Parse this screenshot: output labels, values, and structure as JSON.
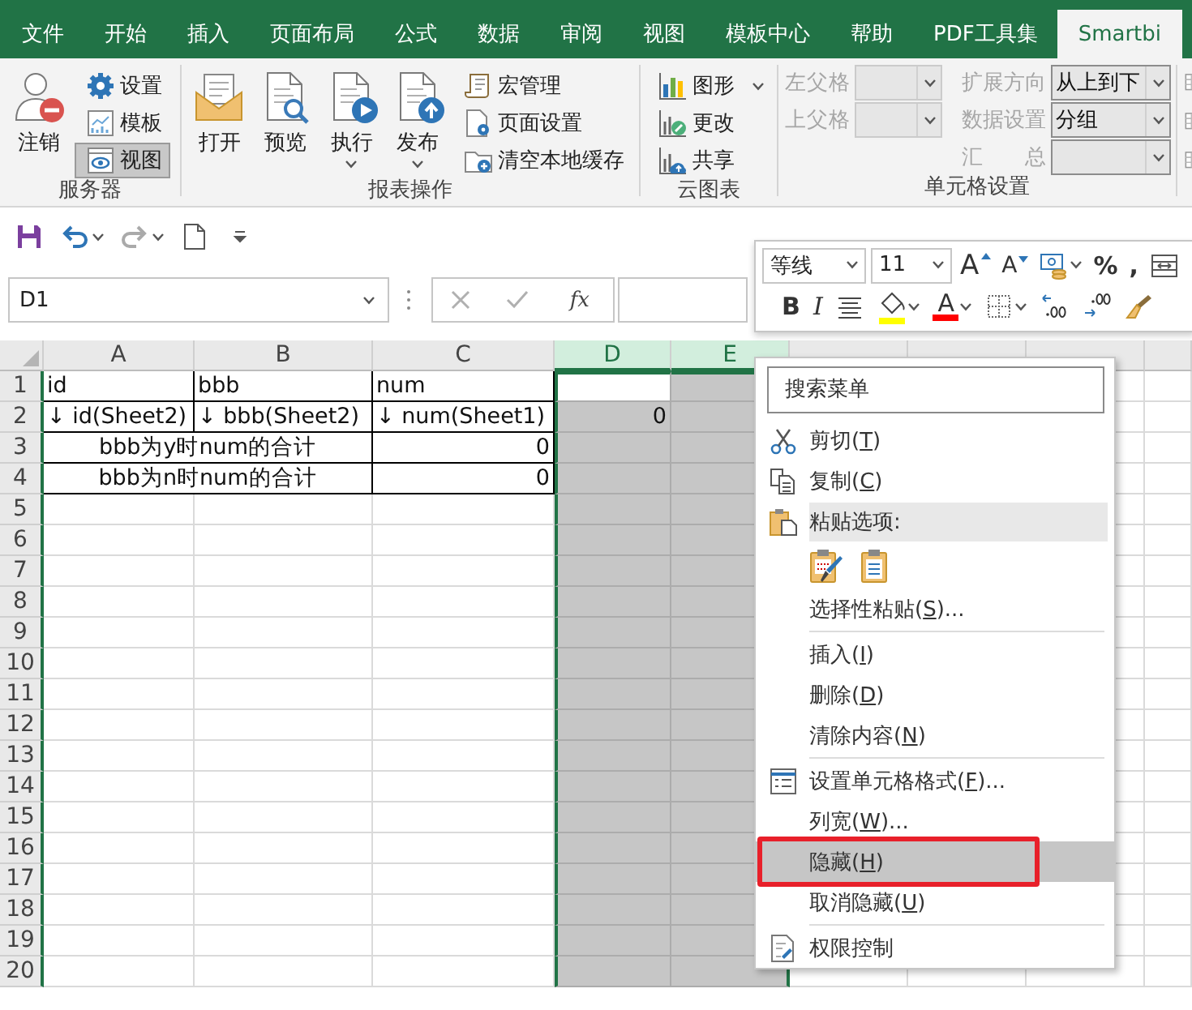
{
  "tabs": [
    {
      "label": "文件",
      "selected": false
    },
    {
      "label": "开始",
      "selected": false
    },
    {
      "label": "插入",
      "selected": false
    },
    {
      "label": "页面布局",
      "selected": false
    },
    {
      "label": "公式",
      "selected": false
    },
    {
      "label": "数据",
      "selected": false
    },
    {
      "label": "审阅",
      "selected": false
    },
    {
      "label": "视图",
      "selected": false
    },
    {
      "label": "模板中心",
      "selected": false
    },
    {
      "label": "帮助",
      "selected": false
    },
    {
      "label": "PDF工具集",
      "selected": false
    },
    {
      "label": "Smartbi",
      "selected": true
    }
  ],
  "ribbon": {
    "groups": [
      {
        "kind": "buttons",
        "label": "服务器",
        "items": [
          {
            "kind": "large",
            "label": "注销",
            "dropdown": false
          },
          {
            "kind": "small",
            "label": "设置",
            "dropdown": false,
            "selected": false
          },
          {
            "kind": "small",
            "label": "模板",
            "dropdown": false,
            "selected": false
          },
          {
            "kind": "small",
            "label": "视图",
            "dropdown": false,
            "selected": true
          }
        ]
      },
      {
        "kind": "buttons",
        "label": "报表操作",
        "items": [
          {
            "kind": "large",
            "label": "打开",
            "dropdown": false
          },
          {
            "kind": "large",
            "label": "预览",
            "dropdown": false
          },
          {
            "kind": "large",
            "label": "执行",
            "dropdown": true
          },
          {
            "kind": "large",
            "label": "发布",
            "dropdown": true
          },
          {
            "kind": "small",
            "label": "宏管理",
            "dropdown": false,
            "selected": false
          },
          {
            "kind": "small",
            "label": "页面设置",
            "dropdown": false,
            "selected": false
          },
          {
            "kind": "small",
            "label": "清空本地缓存",
            "dropdown": false,
            "selected": false
          }
        ]
      },
      {
        "kind": "buttons",
        "label": "云图表",
        "items": [
          {
            "kind": "small",
            "label": "图形",
            "dropdown": true,
            "selected": false
          },
          {
            "kind": "small",
            "label": "更改",
            "dropdown": false,
            "selected": false
          },
          {
            "kind": "small",
            "label": "共享",
            "dropdown": false,
            "selected": false
          }
        ]
      },
      {
        "kind": "fields",
        "label": "单元格设置",
        "columns": [
          [
            {
              "label": "左父格",
              "disabled": true
            },
            {
              "label": "上父格",
              "disabled": true
            }
          ],
          [
            {
              "label": "扩展方向",
              "value": "从上到下",
              "disabled": false
            },
            {
              "label": "数据设置",
              "value": "分组",
              "disabled": false
            },
            {
              "label": "汇 总",
              "disabled": false
            }
          ]
        ]
      }
    ]
  },
  "formula_bar": {
    "name_box": "D1",
    "function_label": "fx"
  },
  "mini_toolbar": {
    "rows": [
      [
        {
          "kind": "combo",
          "value": "等线"
        },
        {
          "kind": "combo",
          "value": "11"
        },
        {
          "kind": "grow",
          "text": "A"
        },
        {
          "kind": "shrink",
          "text": "A"
        },
        {
          "kind": "icon",
          "dropdown": true
        },
        {
          "kind": "glyph",
          "text": "%"
        },
        {
          "kind": "glyph",
          "text": ","
        },
        {
          "kind": "icon",
          "dropdown": false
        }
      ],
      [
        {
          "kind": "bold",
          "text": "B"
        },
        {
          "kind": "italic",
          "text": "I"
        },
        {
          "kind": "icon",
          "dropdown": false
        },
        {
          "kind": "color-icon",
          "color": "#ffff00",
          "dropdown": true
        },
        {
          "kind": "color-glyph",
          "text": "A",
          "color": "#ff0000",
          "dropdown": true
        },
        {
          "kind": "icon",
          "dropdown": true
        },
        {
          "kind": "icon",
          "dropdown": false
        },
        {
          "kind": "icon",
          "dropdown": false
        },
        {
          "kind": "icon",
          "dropdown": false
        }
      ]
    ]
  },
  "sheet": {
    "columns": [
      {
        "label": "A",
        "selected": false
      },
      {
        "label": "B",
        "selected": false
      },
      {
        "label": "C",
        "selected": false
      },
      {
        "label": "D",
        "selected": true
      },
      {
        "label": "E",
        "selected": true
      }
    ],
    "row_headers": [
      "1",
      "2",
      "3",
      "4",
      "5",
      "6",
      "7",
      "8",
      "9",
      "10",
      "11",
      "12",
      "13",
      "14",
      "15",
      "16",
      "17",
      "18",
      "19",
      "20"
    ],
    "rows": [
      [
        {
          "kind": "text",
          "text": "id",
          "bordered": true
        },
        {
          "kind": "text",
          "text": "bbb",
          "bordered": true
        },
        {
          "kind": "text",
          "text": "num",
          "bordered": true
        }
      ],
      [
        {
          "kind": "text",
          "text": "↓ id(Sheet2)",
          "bordered": true
        },
        {
          "kind": "text",
          "text": "↓ bbb(Sheet2)",
          "bordered": true
        },
        {
          "kind": "text",
          "text": "↓ num(Sheet1)",
          "bordered": true
        },
        {
          "kind": "number",
          "text": "0",
          "bordered": false
        }
      ],
      [
        {
          "kind": "merged",
          "text": "bbb为y时num的合计",
          "bordered": true
        },
        {
          "kind": "number",
          "text": "0",
          "bordered": true
        }
      ],
      [
        {
          "kind": "merged",
          "text": "bbb为n时num的合计",
          "bordered": true
        },
        {
          "kind": "number",
          "text": "0",
          "bordered": true
        }
      ]
    ]
  },
  "context_menu": {
    "search": {
      "placeholder": "搜索菜单"
    },
    "items": [
      {
        "kind": "command",
        "before": "剪切(",
        "accelerator": "T",
        "after": ")",
        "selected": false,
        "marked": false
      },
      {
        "kind": "command",
        "before": "复制(",
        "accelerator": "C",
        "after": ")",
        "selected": false,
        "marked": false
      },
      {
        "kind": "heading",
        "label": "粘贴选项:"
      },
      {
        "kind": "paste-options"
      },
      {
        "kind": "command",
        "before": "选择性粘贴(",
        "accelerator": "S",
        "after": ")...",
        "selected": false,
        "marked": false
      },
      {
        "kind": "separator"
      },
      {
        "kind": "command",
        "before": "插入(",
        "accelerator": "I",
        "after": ")",
        "selected": false,
        "marked": false
      },
      {
        "kind": "command",
        "before": "删除(",
        "accelerator": "D",
        "after": ")",
        "selected": false,
        "marked": false
      },
      {
        "kind": "command",
        "before": "清除内容(",
        "accelerator": "N",
        "after": ")",
        "selected": false,
        "marked": false
      },
      {
        "kind": "separator"
      },
      {
        "kind": "command",
        "before": "设置单元格格式(",
        "accelerator": "F",
        "after": ")...",
        "selected": false,
        "marked": false
      },
      {
        "kind": "command",
        "before": "列宽(",
        "accelerator": "W",
        "after": ")...",
        "selected": false,
        "marked": false
      },
      {
        "kind": "command",
        "before": "隐藏(",
        "accelerator": "H",
        "after": ")",
        "selected": true,
        "marked": true
      },
      {
        "kind": "command",
        "before": "取消隐藏(",
        "accelerator": "U",
        "after": ")",
        "selected": false,
        "marked": false
      },
      {
        "kind": "separator"
      },
      {
        "kind": "command",
        "before": "权限控制",
        "selected": false,
        "marked": false
      }
    ]
  }
}
